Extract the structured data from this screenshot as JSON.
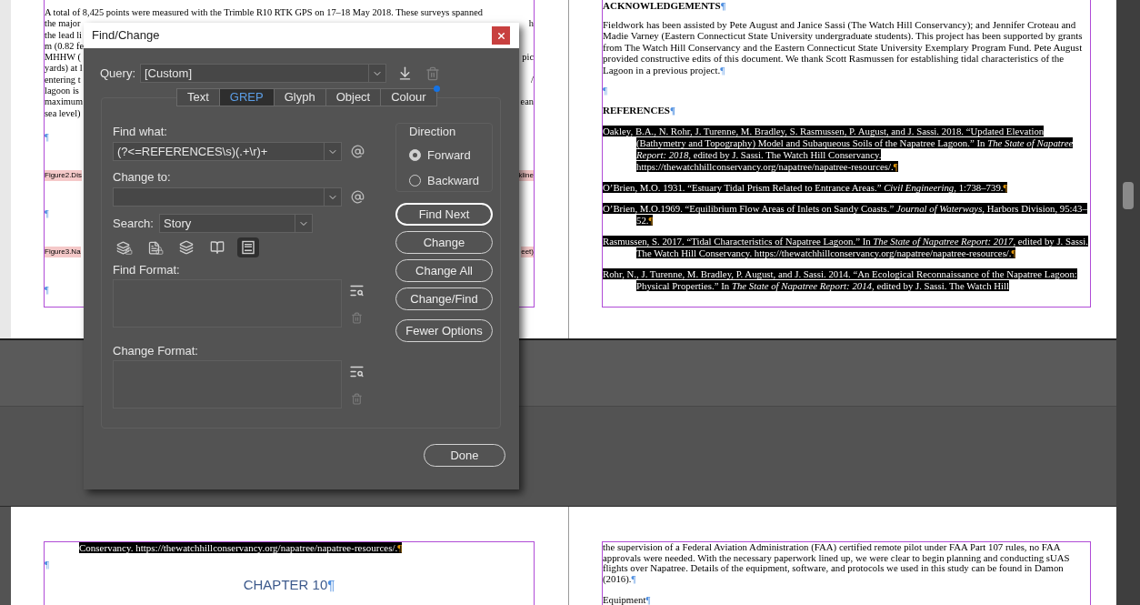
{
  "left_page": {
    "lines": [
      {
        "left": "A total of 8,425 points were measured with the Trimble R10 RTK GPS on 17–18 May 2018. These surveys spanned"
      },
      {
        "left": "the major",
        "right": "h"
      },
      {
        "left": "the lead li"
      },
      {
        "left": "m (0.82 fe"
      },
      {
        "left": "MHHW (",
        "right": "pic"
      },
      {
        "left": "yards) at l"
      },
      {
        "left": "entering t",
        "right": "/"
      },
      {
        "left": "lagoon is"
      },
      {
        "left": "maximum",
        "right": "ean"
      },
      {
        "left": "sea level)"
      }
    ],
    "blocks": [
      {
        "kind": "pilcrow",
        "text": "¶"
      },
      {
        "kind": "caption",
        "left": "Figure2.Dis",
        "right": "kline"
      },
      {
        "kind": "pilcrow",
        "text": "¶"
      },
      {
        "kind": "caption",
        "left": "Figure3.Na",
        "right": "eet)"
      },
      {
        "kind": "pilcrow",
        "text": "¶"
      }
    ]
  },
  "right_page": {
    "heading": "ACKNOWLEDGEMENTS",
    "heading_pilcrow": "¶",
    "paragraph": "Fieldwork has been assisted by Pete August and Janice Sassi (The Watch Hill Conservancy); and Jennifer Croteau and Madie Varney (Eastern Connecticut State University undergraduate students). This project has been supported by grants from The Watch Hill Conservancy and the Eastern Connecticut State University Exemplary Program Fund. Pete August provided constructive edits of this document. We thank Scott Rasmussen for establishing tidal characteristics of the Lagoon in a previous project.",
    "paragraph_pilcrow": "¶",
    "empty_pilcrow": "¶",
    "references_heading": "REFERENCES",
    "references_pilcrow": "¶",
    "references": [
      {
        "text": "Oakley, B.A., N. Rohr, J. Turenne, M. Bradley, S. Rasmussen, P. August, and J. Sassi. 2018. “Updated Elevation (Bathymetry and Topography) Model and Subaqueous Soils of the Napatree Lagoon.” In *The State of Napatree Report: 2018*, edited by J. Sassi. The Watch Hill Conservancy. https://thewatchhillconservancy.org/napatree/napatree-resources/.",
        "pilcrow": "¶",
        "selected": true
      },
      {
        "text": "O’Brien, M.O. 1931. “Estuary Tidal Prism Related to Entrance Areas.” *Civil Engineering*, 1:738–739.",
        "pilcrow": "¶",
        "selected": true
      },
      {
        "text": "O’Brien, M.O.1969. “Equilibrium Flow Areas of Inlets on Sandy Coasts.” *Journal of Waterways*, Harbors Division, 95:43–52.",
        "pilcrow": "¶",
        "selected": true
      },
      {
        "text": "Rasmussen, S. 2017. “Tidal Characteristics of Napatree Lagoon.” In *The State of Napatree Report: 2017*, edited by J. Sassi. The Watch Hill Conservancy. https://thewatchhillconservancy.org/napatree/napatree-resources/.",
        "pilcrow": "¶",
        "selected": true
      },
      {
        "text": "Rohr, N., J. Turenne, M. Bradley, P. August, and J. Sassi. 2014. “An Ecological Reconnaissance of the Napatree Lagoon: Physical Properties.” In *The State of Napatree Report: 2014*, edited by J. Sassi. The Watch Hill",
        "selected": true
      }
    ]
  },
  "bottom_left_page": {
    "text": "Conservancy. https://thewatchhillconservancy.org/napatree/napatree-resources/.",
    "text_pilcrow": "¶",
    "selected": true,
    "empty_pilcrow": "¶",
    "chapter": "CHAPTER 10",
    "chapter_pilcrow": "¶"
  },
  "bottom_right_page": {
    "paragraph": "the supervision of a Federal Aviation Administration (FAA) certified remote pilot under FAA Part 107 rules, no FAA approvals were needed. With the necessary paperwork lined up, we were clear to begin planning and conducting sUAS flights over Napatree. Details of the equipment, software, and protocols we used in this study can be found in Damon (2016).",
    "paragraph_pilcrow": "¶",
    "heading": "Equipment",
    "heading_pilcrow": "¶"
  },
  "dialog": {
    "title": "Find/Change",
    "query": {
      "label": "Query:",
      "value": "[Custom]"
    },
    "tabs": [
      {
        "label": "Text",
        "selected": false,
        "marked": false
      },
      {
        "label": "GREP",
        "selected": true,
        "marked": false
      },
      {
        "label": "Glyph",
        "selected": false,
        "marked": false
      },
      {
        "label": "Object",
        "selected": false,
        "marked": false
      },
      {
        "label": "Colour",
        "selected": false,
        "marked": true
      }
    ],
    "find_what": {
      "label": "Find what:",
      "value": "(?<=REFERENCES\\s)(.+\\r)+"
    },
    "change_to": {
      "label": "Change to:"
    },
    "search": {
      "label": "Search:",
      "value": "Story"
    },
    "options": [
      {
        "kind": "locked-layers",
        "on": false
      },
      {
        "kind": "locked-stories",
        "on": false
      },
      {
        "kind": "hidden-layers",
        "on": false
      },
      {
        "kind": "master-pages",
        "on": false
      },
      {
        "kind": "footnotes",
        "on": true
      }
    ],
    "find_format": {
      "label": "Find Format:"
    },
    "change_format": {
      "label": "Change Format:"
    },
    "direction": {
      "label": "Direction",
      "options": [
        {
          "label": "Forward",
          "selected": true
        },
        {
          "label": "Backward",
          "selected": false
        }
      ]
    },
    "buttons": [
      {
        "label": "Find Next",
        "default": true
      },
      {
        "label": "Change",
        "default": false
      },
      {
        "label": "Change All",
        "default": false
      },
      {
        "label": "Change/Find",
        "default": false
      },
      {
        "label": "Fewer Options",
        "default": false
      }
    ],
    "done": "Done"
  }
}
